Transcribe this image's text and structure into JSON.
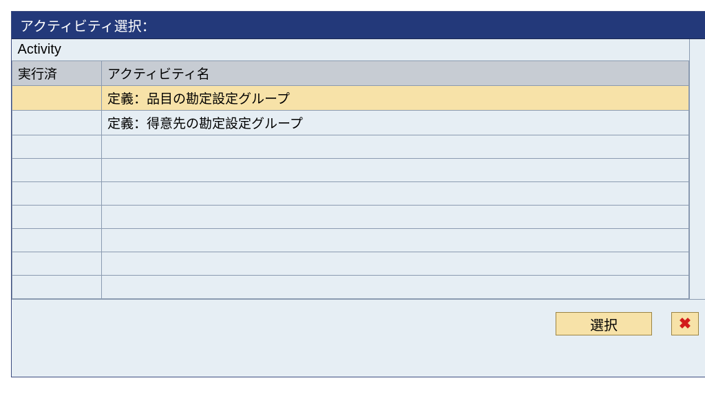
{
  "dialog": {
    "title": "アクティビティ選択："
  },
  "section": {
    "label": "Activity"
  },
  "columns": {
    "executed": "実行済",
    "activity_name": "アクティビティ名"
  },
  "rows": [
    {
      "executed": "",
      "name": "定義：品目の勘定設定グループ",
      "selected": true
    },
    {
      "executed": "",
      "name": "定義：得意先の勘定設定グループ",
      "selected": false
    },
    {
      "executed": "",
      "name": "",
      "selected": false
    },
    {
      "executed": "",
      "name": "",
      "selected": false
    },
    {
      "executed": "",
      "name": "",
      "selected": false
    },
    {
      "executed": "",
      "name": "",
      "selected": false
    },
    {
      "executed": "",
      "name": "",
      "selected": false
    },
    {
      "executed": "",
      "name": "",
      "selected": false
    },
    {
      "executed": "",
      "name": "",
      "selected": false
    }
  ],
  "buttons": {
    "select": "選択",
    "close_symbol": "✖"
  }
}
